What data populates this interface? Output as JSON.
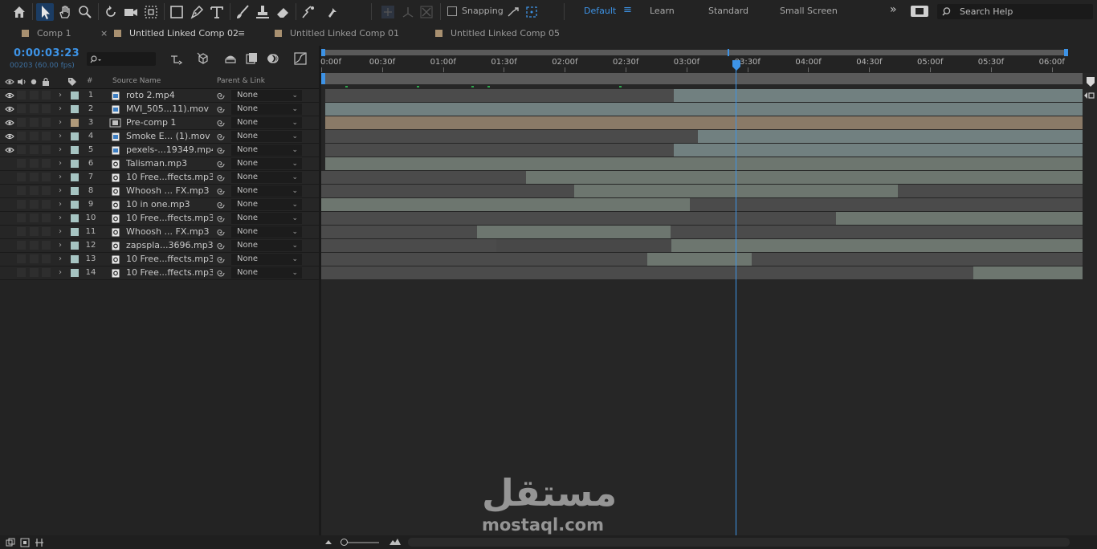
{
  "toolbar": {
    "snapping_label": "Snapping",
    "workspaces": [
      "Default",
      "Learn",
      "Standard",
      "Small Screen"
    ],
    "search_placeholder": "Search Help",
    "icons": [
      "home-icon",
      "selection-icon",
      "hand-icon",
      "zoom-icon",
      "rotate-icon",
      "camera-icon",
      "pan-behind-icon",
      "rectangle-icon",
      "pen-icon",
      "type-icon",
      "brush-icon",
      "clone-stamp-icon",
      "eraser-icon",
      "roto-brush-icon",
      "puppet-pin-icon"
    ]
  },
  "tabs": [
    {
      "label": "Comp 1",
      "swatch": "#a89070",
      "active": false
    },
    {
      "label": "Untitled Linked Comp 02",
      "swatch": "#a89070",
      "active": true
    },
    {
      "label": "Untitled Linked Comp 01",
      "swatch": "#a89070",
      "active": false
    },
    {
      "label": "Untitled Linked Comp 05",
      "swatch": "#a89070",
      "active": false
    }
  ],
  "tab_close_glyph": "×",
  "tab_menu_glyph": "≡",
  "comp": {
    "timecode": "0:00:03:23",
    "frames": "00203 (60.00 fps)"
  },
  "columns": {
    "hash": "#",
    "source_name": "Source Name",
    "parent_link": "Parent & Link"
  },
  "ruler_ticks": [
    "0:00f",
    "00:30f",
    "01:00f",
    "01:30f",
    "02:00f",
    "02:30f",
    "03:00f",
    "03:30f",
    "04:00f",
    "04:30f",
    "05:00f",
    "05:30f",
    "06:00f"
  ],
  "playhead_time": "03:23",
  "layers": [
    {
      "num": "1",
      "name": "roto 2.mp4",
      "type": "video",
      "label_color": "#a6c4c2",
      "parent": "None",
      "av": "eye"
    },
    {
      "num": "2",
      "name": "MVI_505...11).mov",
      "type": "video",
      "label_color": "#a6c4c2",
      "parent": "None",
      "av": "eye"
    },
    {
      "num": "3",
      "name": "Pre-comp 1",
      "type": "comp",
      "label_color": "#b09a7a",
      "parent": "None",
      "av": "eye"
    },
    {
      "num": "4",
      "name": "Smoke E... (1).mov",
      "type": "video",
      "label_color": "#a6c4c2",
      "parent": "None",
      "av": "eye"
    },
    {
      "num": "5",
      "name": "pexels-...19349.mp4",
      "type": "video",
      "label_color": "#a6c4c2",
      "parent": "None",
      "av": "eye"
    },
    {
      "num": "6",
      "name": "Talisman.mp3",
      "type": "audio",
      "label_color": "#a6c4c2",
      "parent": "None",
      "av": "none"
    },
    {
      "num": "7",
      "name": "10 Free...ffects.mp3",
      "type": "audio",
      "label_color": "#a6c4c2",
      "parent": "None",
      "av": "speaker"
    },
    {
      "num": "8",
      "name": "Whoosh ... FX.mp3",
      "type": "audio",
      "label_color": "#a6c4c2",
      "parent": "None",
      "av": "speaker"
    },
    {
      "num": "9",
      "name": "10 in one.mp3",
      "type": "audio",
      "label_color": "#a6c4c2",
      "parent": "None",
      "av": "speaker"
    },
    {
      "num": "10",
      "name": "10 Free...ffects.mp3",
      "type": "audio",
      "label_color": "#a6c4c2",
      "parent": "None",
      "av": "speaker"
    },
    {
      "num": "11",
      "name": "Whoosh ... FX.mp3",
      "type": "audio",
      "label_color": "#a6c4c2",
      "parent": "None",
      "av": "speaker"
    },
    {
      "num": "12",
      "name": "zapspla...3696.mp3",
      "type": "audio",
      "label_color": "#a6c4c2",
      "parent": "None",
      "av": "speaker"
    },
    {
      "num": "13",
      "name": "10 Free...ffects.mp3",
      "type": "audio",
      "label_color": "#a6c4c2",
      "parent": "None",
      "av": "speaker"
    },
    {
      "num": "14",
      "name": "10 Free...ffects.mp3",
      "type": "audio",
      "label_color": "#a6c4c2",
      "parent": "None",
      "av": "speaker"
    }
  ],
  "watermark": {
    "arabic": "مستقل",
    "latin": "mostaql.com"
  }
}
